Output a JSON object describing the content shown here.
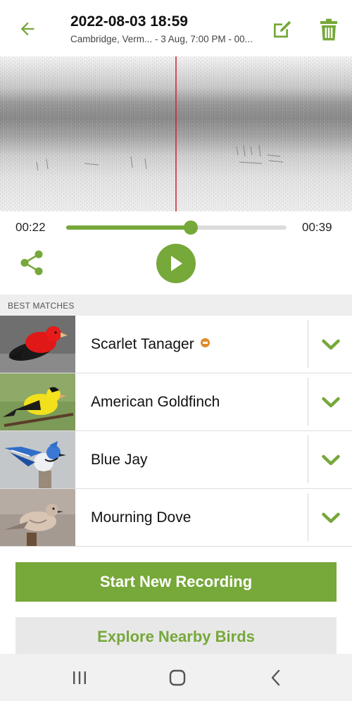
{
  "header": {
    "title": "2022-08-03 18:59",
    "subtitle": "Cambridge, Verm... - 3 Aug, 7:00 PM - 00...",
    "back_icon": "arrow-left-icon",
    "edit_icon": "edit-icon",
    "delete_icon": "trash-icon"
  },
  "player": {
    "current_time": "00:22",
    "total_time": "00:39",
    "progress": 0.564,
    "share_icon": "share-icon",
    "play_icon": "play-icon"
  },
  "matches": {
    "section_title": "BEST MATCHES",
    "items": [
      {
        "name": "Scarlet Tanager",
        "badge": "conservation-status-icon",
        "photo": "scarlet-tanager-photo"
      },
      {
        "name": "American Goldfinch",
        "photo": "american-goldfinch-photo"
      },
      {
        "name": "Blue Jay",
        "photo": "blue-jay-photo"
      },
      {
        "name": "Mourning Dove",
        "photo": "mourning-dove-photo"
      }
    ]
  },
  "actions": {
    "start_recording": "Start New Recording",
    "explore": "Explore Nearby Birds"
  },
  "colors": {
    "accent": "#76a83a",
    "badge": "#e08a2a",
    "playhead": "#c0272d"
  }
}
